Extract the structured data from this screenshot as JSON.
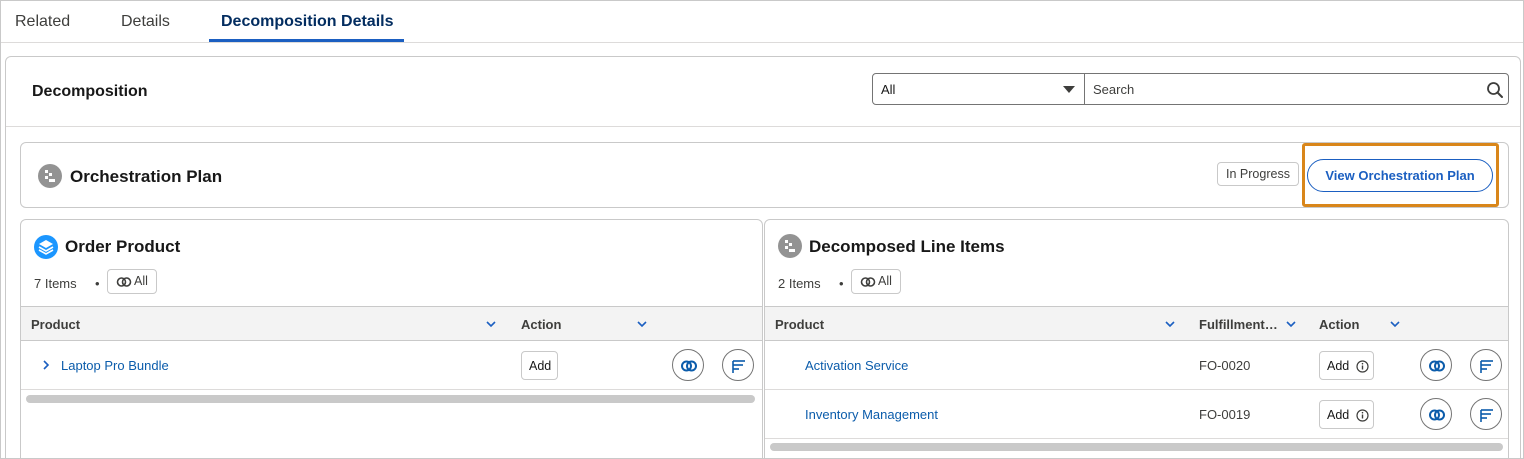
{
  "tabs": [
    {
      "label": "Related"
    },
    {
      "label": "Details"
    },
    {
      "label": "Decomposition Details"
    }
  ],
  "decomposition": {
    "title": "Decomposition",
    "filter_value": "All",
    "search_placeholder": "Search"
  },
  "orchestration": {
    "title": "Orchestration Plan",
    "status": "In Progress",
    "view_button": "View Orchestration Plan"
  },
  "order_product": {
    "title": "Order Product",
    "count": "7 Items",
    "separator": "•",
    "all_label": "All",
    "columns": [
      "Product",
      "Action"
    ],
    "rows": [
      {
        "product": "Laptop Pro Bundle",
        "action": "Add"
      }
    ]
  },
  "decomposed": {
    "title": "Decomposed Line Items",
    "count": "2 Items",
    "separator": "•",
    "all_label": "All",
    "columns": [
      "Product",
      "Fulfillment…",
      "Action"
    ],
    "rows": [
      {
        "product": "Activation Service",
        "fulfillment": "FO-0020",
        "action": "Add"
      },
      {
        "product": "Inventory Management",
        "fulfillment": "FO-0019",
        "action": "Add"
      }
    ]
  },
  "colors": {
    "brand_blue": "#1b5fc1",
    "highlight": "#d9861a"
  }
}
